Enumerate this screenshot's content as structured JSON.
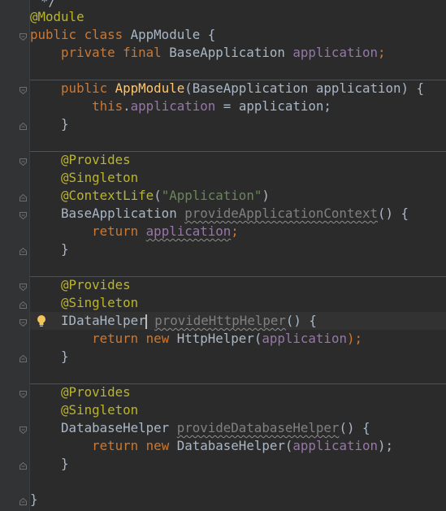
{
  "editor": {
    "top_fragment": "*/",
    "lines": {
      "l1": [
        "@Module"
      ],
      "l2": [
        "public class ",
        "AppModule {"
      ],
      "l3": [
        "    ",
        "private final ",
        "BaseApplication ",
        "application",
        ";"
      ],
      "l5": [
        "    ",
        "public ",
        "AppModule",
        "(BaseApplication application) {"
      ],
      "l6": [
        "        ",
        "this",
        ".",
        "application",
        " = application;"
      ],
      "l7": [
        "    }"
      ],
      "l9": [
        "    ",
        "@Provides"
      ],
      "l10": [
        "    ",
        "@Singleton"
      ],
      "l11": [
        "    ",
        "@ContextLife",
        "(",
        "\"Application\"",
        ")"
      ],
      "l12": [
        "    BaseApplication ",
        "provideApplicationContext",
        "() {"
      ],
      "l13": [
        "        ",
        "return ",
        "application",
        ";"
      ],
      "l14": [
        "    }"
      ],
      "l16": [
        "    ",
        "@Provides"
      ],
      "l17": [
        "    ",
        "@Singleton"
      ],
      "l18": [
        "    IDataHelper",
        " ",
        "provideHttpHelper",
        "() {"
      ],
      "l19": [
        "        ",
        "return new ",
        "HttpHelper(",
        "application",
        ");"
      ],
      "l20": [
        "    }"
      ],
      "l22": [
        "    ",
        "@Provides"
      ],
      "l23": [
        "    ",
        "@Singleton"
      ],
      "l24": [
        "    DatabaseHelper ",
        "provideDatabaseHelper",
        "() {"
      ],
      "l25": [
        "        ",
        "return new ",
        "DatabaseHelper(",
        "application",
        ");"
      ],
      "l26": [
        "    }"
      ],
      "l28": [
        "}"
      ]
    }
  },
  "icons": {
    "intention": "lightbulb-icon",
    "fold": "fold-marker-icon"
  },
  "colors": {
    "background": "#2b2b2b",
    "gutter": "#313335",
    "keyword": "#cc7832",
    "annotation": "#bbb529",
    "field": "#9876aa",
    "method": "#ffc66d",
    "string": "#6a8759",
    "text": "#a9b7c6"
  }
}
